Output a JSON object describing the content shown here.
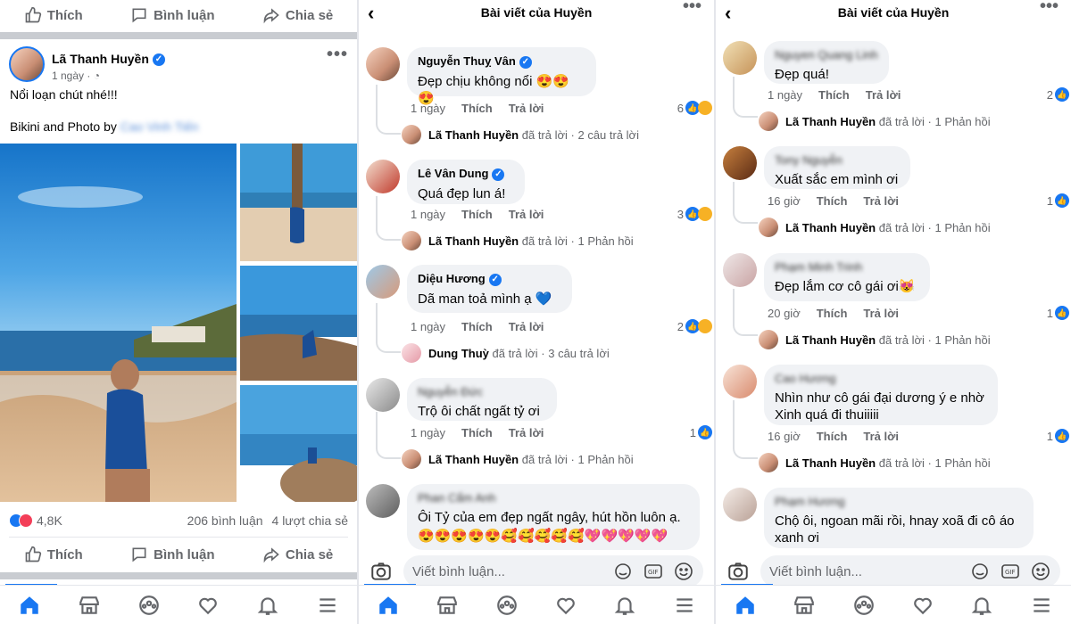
{
  "panel1": {
    "actions_top": {
      "like": "Thích",
      "comment": "Bình luận",
      "share": "Chia sẻ"
    },
    "post": {
      "author": "Lã Thanh Huyền",
      "time": "1 ngày ·",
      "caption": "Nổi loạn chút nhé!!!",
      "credit_prefix": "Bikini and Photo by",
      "credit_name": "Cao Vinh Tiến",
      "reactions": "4,8K",
      "comments": "206 bình luận",
      "shares": "4 lượt chia sẻ"
    },
    "actions_bottom": {
      "like": "Thích",
      "comment": "Bình luận",
      "share": "Chia sẻ"
    },
    "colors": {
      "accent": "#1877f2",
      "sea": "#1f73c4",
      "sand": "#d9b48a"
    }
  },
  "panel2": {
    "title": "Bài viết của Huyền",
    "comments": [
      {
        "name": "Nguyễn Thuỵ Vân",
        "verified": true,
        "text": "Đẹp chịu không nổi 😍😍😍",
        "time": "1 ngày",
        "like": "Thích",
        "reply": "Trả lời",
        "count": "6",
        "reply_name": "Lã Thanh Huyền",
        "reply_action": "đã trả lời",
        "reply_count": "· 2 câu trả lời"
      },
      {
        "name": "Lê Vân Dung",
        "verified": true,
        "text": "Quá đẹp lun á!",
        "time": "1 ngày",
        "like": "Thích",
        "reply": "Trả lời",
        "count": "3",
        "reply_name": "Lã Thanh Huyền",
        "reply_action": "đã trả lời",
        "reply_count": "· 1 Phản hồi"
      },
      {
        "name": "Diệu Hương",
        "verified": true,
        "text": "Dã man toả mình ạ 💙",
        "time": "1 ngày",
        "like": "Thích",
        "reply": "Trả lời",
        "count": "2",
        "reply_name": "Dung Thuỳ",
        "reply_action": "đã trả lời",
        "reply_count": "· 3 câu trả lời"
      },
      {
        "name": "Nguyễn Đức",
        "verified": false,
        "text": "Trộ ôi chất ngất tỷ ơi",
        "time": "1 ngày",
        "like": "Thích",
        "reply": "Trả lời",
        "count": "1",
        "reply_name": "Lã Thanh Huyền",
        "reply_action": "đã trả lời",
        "reply_count": "· 1 Phản hồi"
      },
      {
        "name": "Phan Cẩm Anh",
        "verified": false,
        "text": "Ôi Tỷ của em đẹp ngất ngây, hút hồn luôn ạ.",
        "text2": "😍😍😍😍😍🥰🥰🥰🥰🥰💖💖💖💖💖"
      }
    ],
    "input_placeholder": "Viết bình luận..."
  },
  "panel3": {
    "title": "Bài viết của Huyền",
    "comments": [
      {
        "name": "Nguyen Quang Linh",
        "text": "Đẹp quá!",
        "time": "1 ngày",
        "like": "Thích",
        "reply": "Trả lời",
        "count": "2",
        "reply_name": "Lã Thanh Huyền",
        "reply_action": "đã trả lời",
        "reply_count": "· 1 Phản hồi"
      },
      {
        "name": "Tony Nguyễn",
        "text": "Xuất sắc em mình ơi",
        "time": "16 giờ",
        "like": "Thích",
        "reply": "Trả lời",
        "count": "1",
        "reply_name": "Lã Thanh Huyền",
        "reply_action": "đã trả lời",
        "reply_count": "· 1 Phản hồi"
      },
      {
        "name": "Phạm Minh Trinh",
        "text": "Đẹp lắm cơ cô gái ơi😻",
        "time": "20 giờ",
        "like": "Thích",
        "reply": "Trả lời",
        "count": "1",
        "reply_name": "Lã Thanh Huyền",
        "reply_action": "đã trả lời",
        "reply_count": "· 1 Phản hồi"
      },
      {
        "name": "Cao Hương",
        "text": "Nhìn như cô gái đại dương ý e nhờ",
        "text2": "Xinh quá đi thuiiiii",
        "time": "16 giờ",
        "like": "Thích",
        "reply": "Trả lời",
        "count": "1",
        "reply_name": "Lã Thanh Huyền",
        "reply_action": "đã trả lời",
        "reply_count": "· 1 Phản hồi"
      },
      {
        "name": "Phạm Hương",
        "text": "Chộ ôi, ngoan mãi rồi, hnay xoã đi cô áo",
        "text2": "xanh ơi"
      }
    ],
    "input_placeholder": "Viết bình luận..."
  },
  "icons": [
    "like-icon",
    "comment-icon",
    "share-icon",
    "home-icon",
    "marketplace-icon",
    "groups-icon",
    "dating-icon",
    "bell-icon",
    "menu-icon",
    "camera-icon",
    "sticker-icon",
    "gif-icon",
    "emoji-icon"
  ]
}
